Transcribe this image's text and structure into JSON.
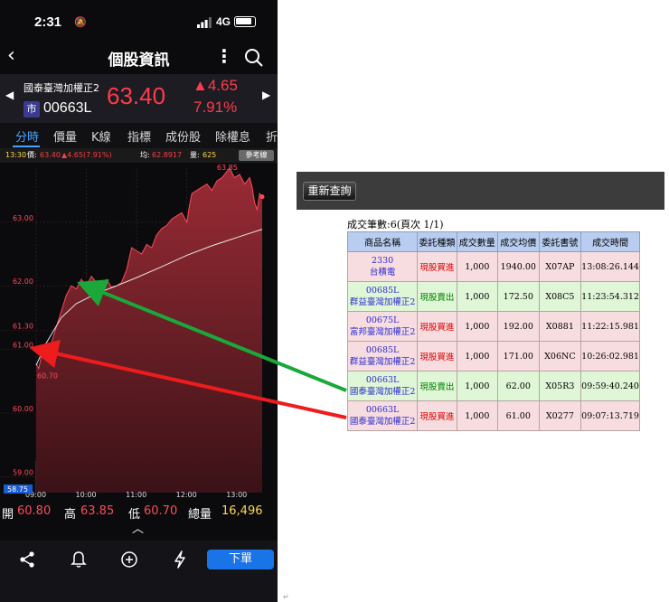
{
  "status_bar": {
    "time": "2:31",
    "network": "4G"
  },
  "nav": {
    "title": "個股資訊"
  },
  "quote": {
    "name": "國泰臺灣加權正2",
    "market_badge": "市",
    "code": "00663L",
    "price": "63.40",
    "change": "▲4.65",
    "change_pct": "7.91%"
  },
  "tabs": [
    "分時",
    "價量",
    "K線",
    "指標",
    "成份股",
    "除權息",
    "折"
  ],
  "info_strip": {
    "time": "13:30",
    "price_label": "價:",
    "price": "63.40",
    "change": "▲4.65(7.91%)",
    "avg_label": "均:",
    "avg": "62.8917",
    "volume_label": "量:",
    "volume": "625",
    "reference_button": "參考線"
  },
  "chart_data": {
    "type": "area",
    "x_ticks": [
      "09:00",
      "10:00",
      "11:00",
      "12:00",
      "13:00"
    ],
    "y_ticks": [
      "63.00",
      "62.00",
      "61.30",
      "61.00",
      "60.00",
      "59.00"
    ],
    "y_range": [
      58.75,
      63.85
    ],
    "high_label": "63.85",
    "low_label": "60.70",
    "base_label": "58.75",
    "price_series": [
      [
        0,
        60.78
      ],
      [
        0.05,
        60.7
      ],
      [
        0.12,
        60.95
      ],
      [
        0.2,
        61.05
      ],
      [
        0.3,
        61.1
      ],
      [
        0.4,
        61.35
      ],
      [
        0.5,
        61.6
      ],
      [
        0.6,
        61.85
      ],
      [
        0.7,
        62.0
      ],
      [
        0.8,
        61.95
      ],
      [
        0.9,
        62.1
      ],
      [
        1.0,
        62.0
      ],
      [
        1.1,
        62.15
      ],
      [
        1.2,
        62.05
      ],
      [
        1.3,
        61.9
      ],
      [
        1.4,
        62.1
      ],
      [
        1.5,
        61.98
      ],
      [
        1.6,
        62.0
      ],
      [
        1.7,
        62.05
      ],
      [
        1.8,
        62.25
      ],
      [
        1.9,
        62.6
      ],
      [
        2.0,
        62.55
      ],
      [
        2.1,
        62.5
      ],
      [
        2.2,
        62.65
      ],
      [
        2.3,
        62.6
      ],
      [
        2.4,
        62.8
      ],
      [
        2.5,
        62.9
      ],
      [
        2.6,
        62.95
      ],
      [
        2.7,
        63.05
      ],
      [
        2.8,
        63.1
      ],
      [
        2.9,
        63.15
      ],
      [
        3.0,
        63.0
      ],
      [
        3.05,
        63.25
      ],
      [
        3.1,
        63.45
      ],
      [
        3.2,
        63.5
      ],
      [
        3.3,
        63.55
      ],
      [
        3.4,
        63.6
      ],
      [
        3.5,
        63.5
      ],
      [
        3.6,
        63.65
      ],
      [
        3.7,
        63.7
      ],
      [
        3.8,
        63.8
      ],
      [
        3.85,
        63.85
      ],
      [
        3.95,
        63.7
      ],
      [
        4.05,
        63.75
      ],
      [
        4.15,
        63.6
      ],
      [
        4.25,
        63.7
      ],
      [
        4.3,
        63.55
      ],
      [
        4.35,
        63.3
      ],
      [
        4.4,
        63.2
      ],
      [
        4.45,
        63.45
      ],
      [
        4.5,
        63.4
      ]
    ],
    "avg_series": [
      [
        0,
        60.75
      ],
      [
        0.2,
        61.1
      ],
      [
        0.5,
        61.5
      ],
      [
        0.8,
        61.72
      ],
      [
        1.2,
        61.88
      ],
      [
        1.6,
        62.0
      ],
      [
        2.0,
        62.13
      ],
      [
        2.5,
        62.3
      ],
      [
        3.0,
        62.48
      ],
      [
        3.5,
        62.63
      ],
      [
        4.0,
        62.76
      ],
      [
        4.5,
        62.89
      ]
    ]
  },
  "stats": {
    "open_label": "開",
    "open": "60.80",
    "high_label": "高",
    "high": "63.85",
    "low_label": "低",
    "low": "60.70",
    "volume_label": "總量",
    "volume": "16,496"
  },
  "bottom_bar": {
    "order_button": "下單"
  },
  "icons": [
    "share-icon",
    "bell-icon",
    "add-circle-icon",
    "flash-icon"
  ],
  "query_panel": {
    "requery_button": "重新查詢",
    "summary": "成交筆數:6(頁次 1/1)",
    "headers": [
      "商品名稱",
      "委託種類",
      "成交數量",
      "成交均價",
      "委託書號",
      "成交時間"
    ],
    "rows": [
      {
        "side": "buy",
        "code": "2330",
        "name": "台積電",
        "type": "現股買進",
        "qty": "1,000",
        "price": "1940.00",
        "order_no": "X07AP",
        "time": "13:08:26.144"
      },
      {
        "side": "sell",
        "code": "00685L",
        "name": "群益臺灣加權正2",
        "type": "現股賣出",
        "qty": "1,000",
        "price": "172.50",
        "order_no": "X08C5",
        "time": "11:23:54.312"
      },
      {
        "side": "buy",
        "code": "00675L",
        "name": "富邦臺灣加權正2",
        "type": "現股買進",
        "qty": "1,000",
        "price": "192.00",
        "order_no": "X0881",
        "time": "11:22:15.981"
      },
      {
        "side": "buy",
        "code": "00685L",
        "name": "群益臺灣加權正2",
        "type": "現股買進",
        "qty": "1,000",
        "price": "171.00",
        "order_no": "X06NC",
        "time": "10:26:02.981"
      },
      {
        "side": "sell",
        "code": "00663L",
        "name": "國泰臺灣加權正2",
        "type": "現股賣出",
        "qty": "1,000",
        "price": "62.00",
        "order_no": "X05R3",
        "time": "09:59:40.240"
      },
      {
        "side": "buy",
        "code": "00663L",
        "name": "國泰臺灣加權正2",
        "type": "現股買進",
        "qty": "1,000",
        "price": "61.00",
        "order_no": "X0277",
        "time": "09:07:13.719"
      }
    ]
  },
  "colors": {
    "up": "#ff3b4a",
    "accent": "#4aa3ff",
    "sell_arrow": "#1aa83a",
    "buy_arrow": "#ee1c1c"
  }
}
